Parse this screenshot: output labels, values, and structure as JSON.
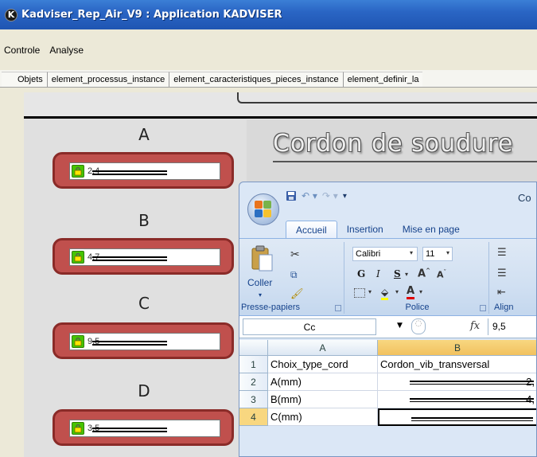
{
  "window": {
    "title": "Kadviser_Rep_Air_V9 : Application KADVISER",
    "icon": "K"
  },
  "menubar": {
    "items": [
      "Controle",
      "Analyse"
    ]
  },
  "tabs": [
    "Objets",
    "element_processus_instance",
    "element_caracteristiques_pieces_instance",
    "element_definir_la"
  ],
  "canvas": {
    "title": "Cordon de soudure",
    "dimensions": [
      {
        "label": "A",
        "value": "2,4",
        "lock_color": "#46c400"
      },
      {
        "label": "B",
        "value": "4,7",
        "lock_color": "#46c400"
      },
      {
        "label": "C",
        "value": "9,5",
        "lock_color": "#46c400"
      },
      {
        "label": "D",
        "value": "3,5",
        "lock_color": "#46c400"
      }
    ]
  },
  "excel": {
    "title_partial": "Co",
    "ribbon_tabs": [
      "Accueil",
      "Insertion",
      "Mise en page"
    ],
    "active_tab": "Accueil",
    "clipboard": {
      "paste_label": "Coller",
      "group_label": "Presse-papiers"
    },
    "font": {
      "family": "Calibri",
      "size": "11",
      "group_label": "Police",
      "bold": "G",
      "italic": "I",
      "underline": "S"
    },
    "alignment": {
      "group_label": "Align"
    },
    "formula_bar": {
      "name_box": "Cc",
      "fx": "fx",
      "value": "9,5"
    },
    "columns": [
      "A",
      "B"
    ],
    "rows": [
      {
        "num": "1",
        "a": "Choix_type_cord",
        "b": "Cordon_vib_transversal"
      },
      {
        "num": "2",
        "a": "A(mm)",
        "b": "2,"
      },
      {
        "num": "3",
        "a": "B(mm)",
        "b": "4,"
      },
      {
        "num": "4",
        "a": "C(mm)",
        "b": ""
      }
    ]
  },
  "colors": {
    "titlebar": "#2a65c4",
    "dim_box": "#c0504d",
    "excel_selected_col": "#f1c15f"
  }
}
